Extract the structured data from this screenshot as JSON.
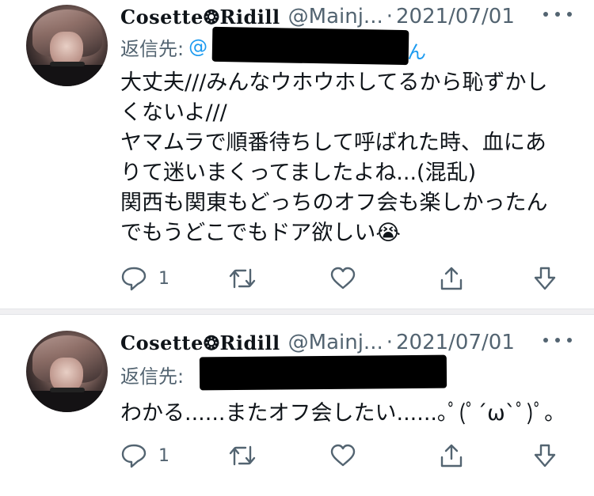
{
  "tweets": [
    {
      "display_name": "Cosette❂Ridill",
      "handle": "@Mainj...",
      "separator": "·",
      "date": "2021/07/01",
      "reply_label": "返信先:",
      "reply_mention_visible": "@",
      "reply_mention_tail": "ん",
      "text_lines": [
        "大丈夫///みんなウホウホしてるから恥ずかし",
        "くないよ///",
        "ヤマムラで順番待ちして呼ばれた時、血にあ",
        "りて迷いまくってましたよね...(混乱)",
        "関西も関東もどっちのオフ会も楽しかったん",
        "でもうどこでもドア欲しい😭"
      ],
      "reply_count": "1",
      "icons": [
        "reply-icon",
        "retweet-icon",
        "like-icon",
        "share-icon",
        "download-icon"
      ]
    },
    {
      "display_name": "Cosette❂Ridill",
      "handle": "@Mainj...",
      "separator": "·",
      "date": "2021/07/01",
      "reply_label": "返信先:",
      "text_lines": [
        "わかる......またオフ会したい......｡ﾟ(ﾟ´ω`ﾟ)ﾟ｡"
      ],
      "reply_count": "1",
      "icons": [
        "reply-icon",
        "retweet-icon",
        "like-icon",
        "share-icon",
        "download-icon"
      ]
    }
  ],
  "colors": {
    "text_primary": "#0f1419",
    "text_secondary": "#536471",
    "link": "#1d9bf0",
    "divider": "#f0f0f2"
  }
}
